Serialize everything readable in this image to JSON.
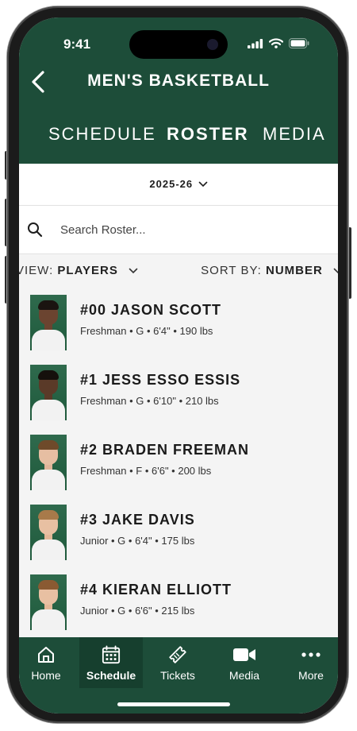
{
  "status_bar": {
    "time": "9:41"
  },
  "header": {
    "title": "MEN'S BASKETBALL"
  },
  "tabs": [
    {
      "label": "SCHEDULE",
      "active": false
    },
    {
      "label": "ROSTER",
      "active": true
    },
    {
      "label": "MEDIA",
      "active": false
    }
  ],
  "season": {
    "selected": "2025-26"
  },
  "search": {
    "placeholder": "Search Roster..."
  },
  "filters": {
    "view_prefix": "VIEW: ",
    "view_value": "PLAYERS",
    "sort_prefix": "SORT BY: ",
    "sort_value": "NUMBER"
  },
  "players": [
    {
      "name": "#00 JASON SCOTT",
      "meta": "Freshman • G • 6'4\" • 190 lbs"
    },
    {
      "name": "#1 JESS ESSO ESSIS",
      "meta": "Freshman • G • 6'10\" • 210 lbs"
    },
    {
      "name": "#2 BRADEN FREEMAN",
      "meta": "Freshman • F • 6'6\" • 200 lbs"
    },
    {
      "name": "#3 JAKE DAVIS",
      "meta": "Junior • G • 6'4\" • 175 lbs"
    },
    {
      "name": "#4 KIERAN ELLIOTT",
      "meta": "Junior • G • 6'6\" • 215 lbs"
    }
  ],
  "tab_bar": [
    {
      "label": "Home",
      "icon": "home-icon",
      "active": false
    },
    {
      "label": "Schedule",
      "icon": "calendar-icon",
      "active": true
    },
    {
      "label": "Tickets",
      "icon": "ticket-icon",
      "active": false
    },
    {
      "label": "Media",
      "icon": "video-camera-icon",
      "active": false
    },
    {
      "label": "More",
      "icon": "more-dots-icon",
      "active": false
    }
  ],
  "colors": {
    "brand_green": "#1d4d39",
    "active_tab": "#163f2e",
    "background": "#f4f4f4"
  }
}
